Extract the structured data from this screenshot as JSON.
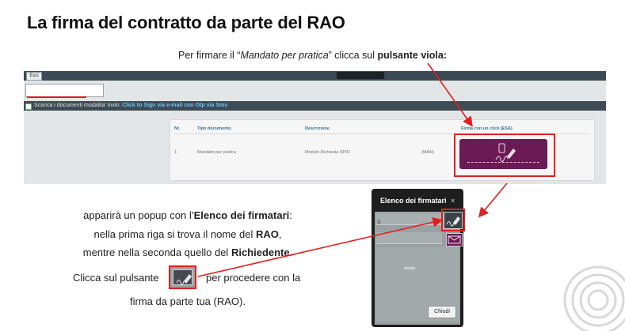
{
  "title": "La firma del contratto da parte del RAO",
  "instruction": {
    "prefix": "Per firmare il “",
    "italic": "Mandato per pratica",
    "middle": "” clicca sul ",
    "bold": "pulsante viola:"
  },
  "app": {
    "exit_label": "Esci",
    "bar_checkbox_text": "Scarica i documenti   modalita' invio: ",
    "bar_link_text": "Click to Sign via e-mail con Otp via Sms",
    "table": {
      "headers": [
        "Nr.",
        "Tipo documento",
        "Descrizione",
        "Firma con un click (ESA)"
      ],
      "row": {
        "nr": "1",
        "tipo": "Mandato per pratica",
        "descrizione": "Modulo Richiesta SPID",
        "extra": "(MAN)"
      }
    },
    "sign_button_icon": "pen-sign-icon"
  },
  "explanation": {
    "line1_prefix": "apparirà un popup con l’",
    "line1_bold": "Elenco dei firmatari",
    "line1_suffix": ":",
    "line2_prefix": "nella prima riga si trova il nome del ",
    "line2_bold": "RAO",
    "line2_suffix": ",",
    "line3_prefix": "mentre nella seconda quello del ",
    "line3_bold": "Richiedente",
    "line3_suffix": ".",
    "line4_prefix": "Clicca sul pulsante",
    "line4_suffix": "per procedere con la",
    "line5": "firma da parte tua (RAO)."
  },
  "popup": {
    "title": "Elenco dei firmatari",
    "close_symbol": "×",
    "row1_initial": "E",
    "close_button": "Chiudi"
  },
  "colors": {
    "accent_purple": "#6b1a55",
    "highlight_red": "#e02020",
    "header_dark": "#3a4954"
  }
}
